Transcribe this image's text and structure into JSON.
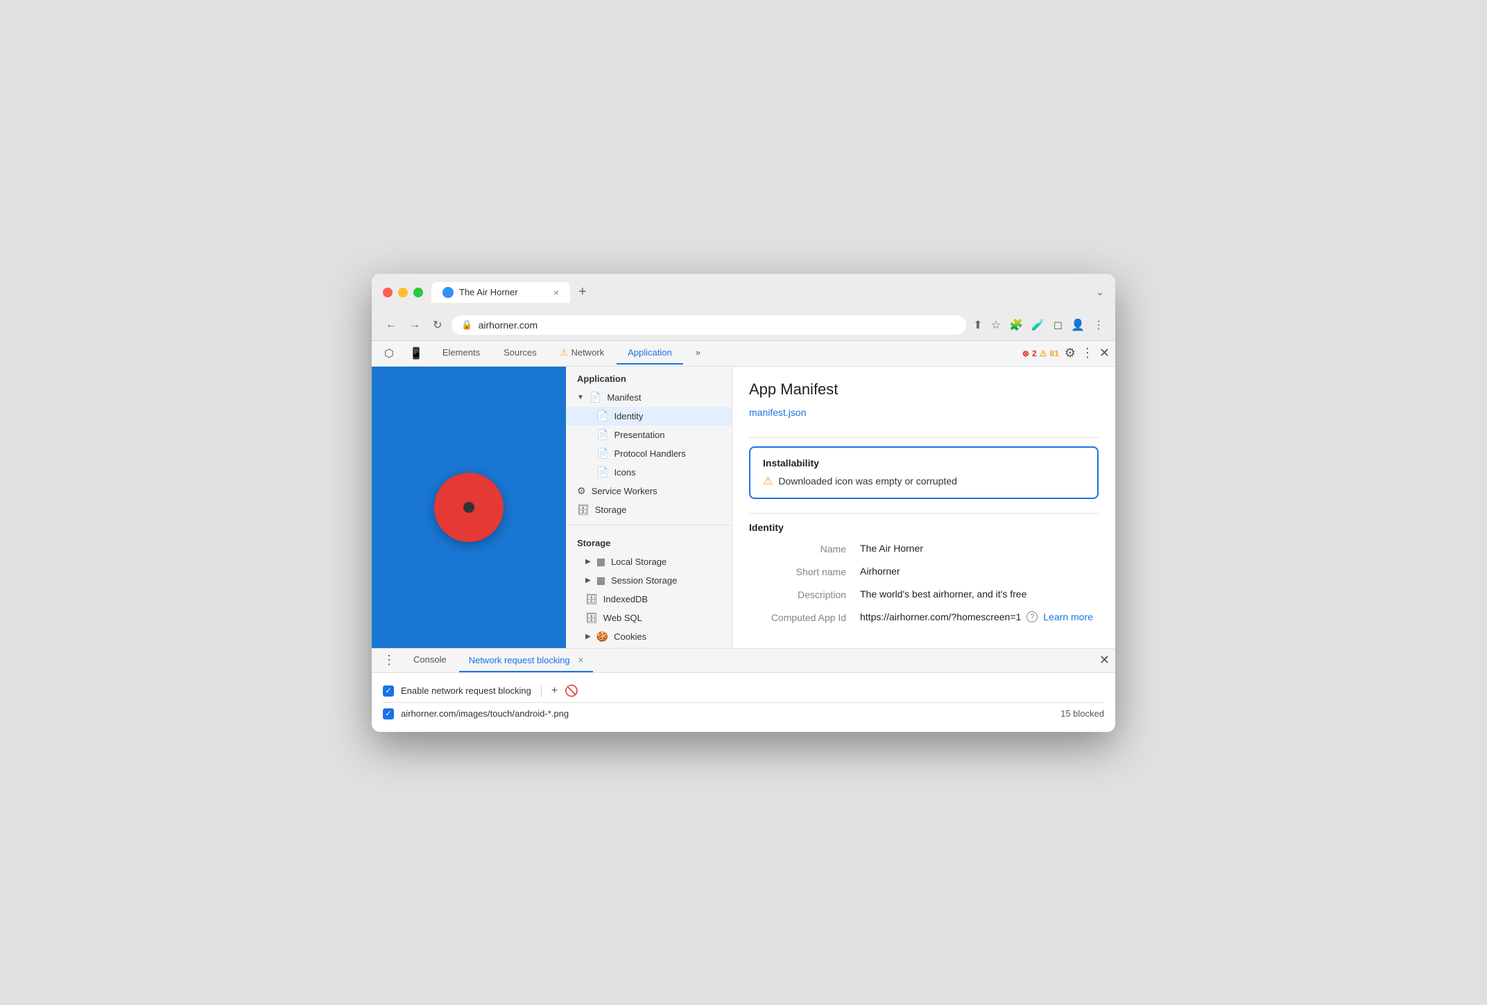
{
  "browser": {
    "tab_title": "The Air Horner",
    "tab_close": "×",
    "tab_new": "+",
    "tab_expand": "⌄",
    "url": "airhorner.com",
    "lock_symbol": "🔒"
  },
  "nav_buttons": {
    "back": "←",
    "forward": "→",
    "refresh": "↻"
  },
  "devtools_tabs": [
    {
      "label": "Elements",
      "active": false
    },
    {
      "label": "Sources",
      "active": false
    },
    {
      "label": "Network",
      "active": false,
      "warning": true
    },
    {
      "label": "Application",
      "active": true
    },
    {
      "label": "»",
      "active": false
    }
  ],
  "devtools_badges": {
    "errors": "2",
    "warnings": "81",
    "error_icon": "⊗",
    "warn_icon": "⚠"
  },
  "sidebar": {
    "application_header": "Application",
    "manifest_label": "Manifest",
    "manifest_children": [
      {
        "label": "Identity"
      },
      {
        "label": "Presentation"
      },
      {
        "label": "Protocol Handlers"
      },
      {
        "label": "Icons"
      }
    ],
    "service_workers_label": "Service Workers",
    "storage_label": "Storage",
    "storage_header": "Storage",
    "storage_children": [
      {
        "label": "Local Storage",
        "expandable": true
      },
      {
        "label": "Session Storage",
        "expandable": true
      },
      {
        "label": "IndexedDB"
      },
      {
        "label": "Web SQL"
      },
      {
        "label": "Cookies",
        "expandable": true
      }
    ]
  },
  "main": {
    "page_title": "App Manifest",
    "manifest_link": "manifest.json",
    "installability": {
      "title": "Installability",
      "message": "Downloaded icon was empty or corrupted",
      "warn_icon": "⚠"
    },
    "identity_section": "Identity",
    "fields": [
      {
        "label": "Name",
        "value": "The Air Horner"
      },
      {
        "label": "Short name",
        "value": "Airhorner"
      },
      {
        "label": "Description",
        "value": "The world's best airhorner, and it's free"
      },
      {
        "label": "Computed App Id",
        "value": "https://airhorner.com/?homescreen=1",
        "has_help": true,
        "has_link": true,
        "link_text": "Learn more"
      }
    ]
  },
  "bottom_bar": {
    "console_tab": "Console",
    "network_tab": "Network request blocking",
    "network_tab_close": "×",
    "enable_label": "Enable network request blocking",
    "add_icon": "+",
    "block_icon": "🚫",
    "blocked_path": "airhorner.com/images/touch/android-*.png",
    "blocked_count": "15 blocked"
  }
}
